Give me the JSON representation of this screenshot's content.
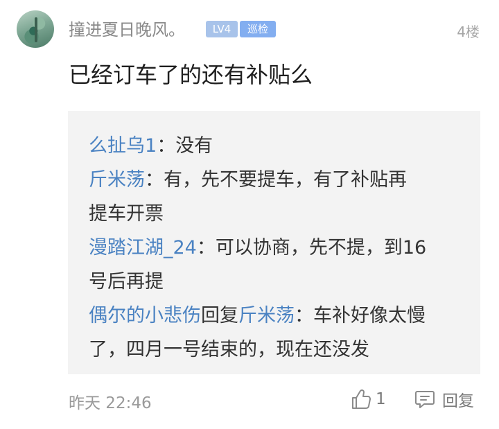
{
  "post": {
    "username": "撞进夏日晚风。",
    "level_badge": "LV4",
    "role_badge": "巡检",
    "floor": "4楼",
    "content": "已经订车了的还有补贴么",
    "time": "昨天 22:46",
    "like_count": "1",
    "reply_label": "回复"
  },
  "replies": [
    {
      "user": "么扯乌1",
      "sep": "：",
      "text": "没有"
    },
    {
      "user": "斤米荡",
      "sep": "：",
      "text": "有，先不要提车，有了补贴再",
      "cont": "提车开票"
    },
    {
      "user": "漫踏江湖_24",
      "sep": "：",
      "text": "可以协商，先不提，到16",
      "cont": "号后再提"
    },
    {
      "user": "偶尔的小悲伤",
      "reply_word": "回复",
      "target": "斤米荡",
      "sep": "：",
      "text": "车补好像太慢",
      "cont": "了，四月一号结束的，现在还没发"
    }
  ],
  "colors": {
    "link": "#4a82c2",
    "level_badge_bg": "#a8c3ea",
    "role_badge_bg": "#83aef0",
    "reply_bg": "#f3f3f3"
  },
  "icons": [
    "thumbs-up-icon",
    "comment-icon"
  ]
}
